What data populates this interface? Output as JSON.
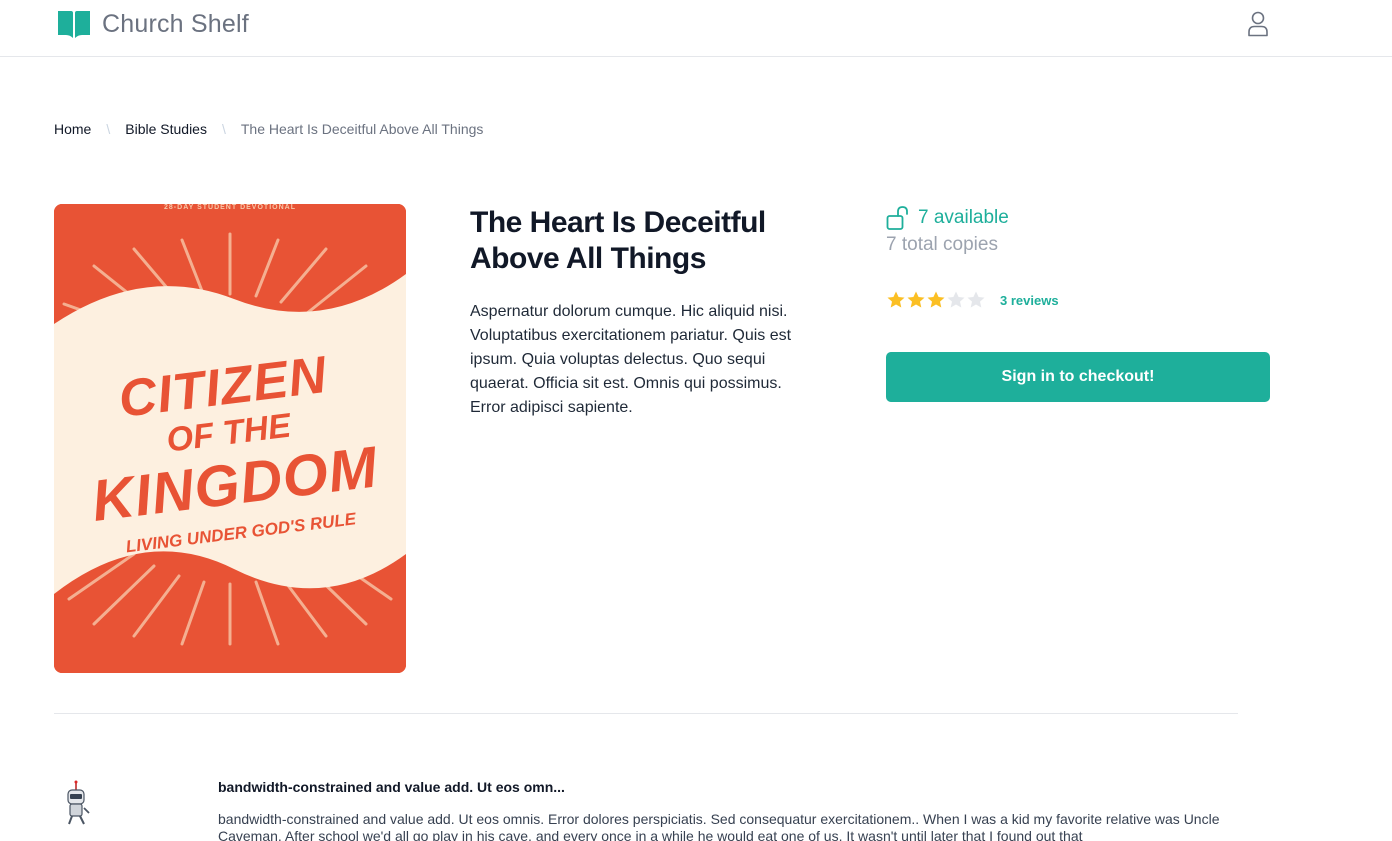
{
  "header": {
    "app_name": "Church Shelf",
    "logo_icon": "open-book-icon",
    "user_icon": "user-icon"
  },
  "breadcrumb": {
    "items": [
      "Home",
      "Bible Studies"
    ],
    "current": "The Heart Is Deceitful Above All Things",
    "separator": "\\"
  },
  "book": {
    "cover": {
      "top_text": "28-DAY STUDENT DEVOTIONAL",
      "line1": "CITIZEN",
      "line2": "OF THE",
      "line3": "KINGDOM",
      "subtitle": "LIVING UNDER GOD'S RULE"
    },
    "title": "The Heart Is Deceitful Above All Things",
    "description": "Aspernatur dolorum cumque. Hic aliquid nisi. Voluptatibus exercitationem pariatur. Quis est ipsum. Quia voluptas delectus. Quo sequi quaerat. Officia sit est. Omnis qui possimus. Error adipisci sapiente."
  },
  "availability": {
    "icon": "unlock-icon",
    "available_text": "7 available",
    "total_text": "7 total copies"
  },
  "rating": {
    "value": 3,
    "max": 5,
    "reviews_text": "3 reviews"
  },
  "checkout": {
    "label": "Sign in to checkout!"
  },
  "review": {
    "avatar_icon": "robot-avatar-icon",
    "title": "bandwidth-constrained and value add. Ut eos omn...",
    "body": "bandwidth-constrained and value add. Ut eos omnis. Error dolores perspiciatis. Sed consequatur exercitationem.. When I was a kid my favorite relative was Uncle Caveman. After school we'd all go play in his cave, and every once in a while he would eat one of us. It wasn't until later that I found out that"
  },
  "colors": {
    "accent": "#1eaf9b",
    "star_filled": "#fbbf24",
    "star_empty": "#e5e7eb",
    "cover_orange": "#e85335",
    "cover_cream": "#fdf0e0"
  }
}
